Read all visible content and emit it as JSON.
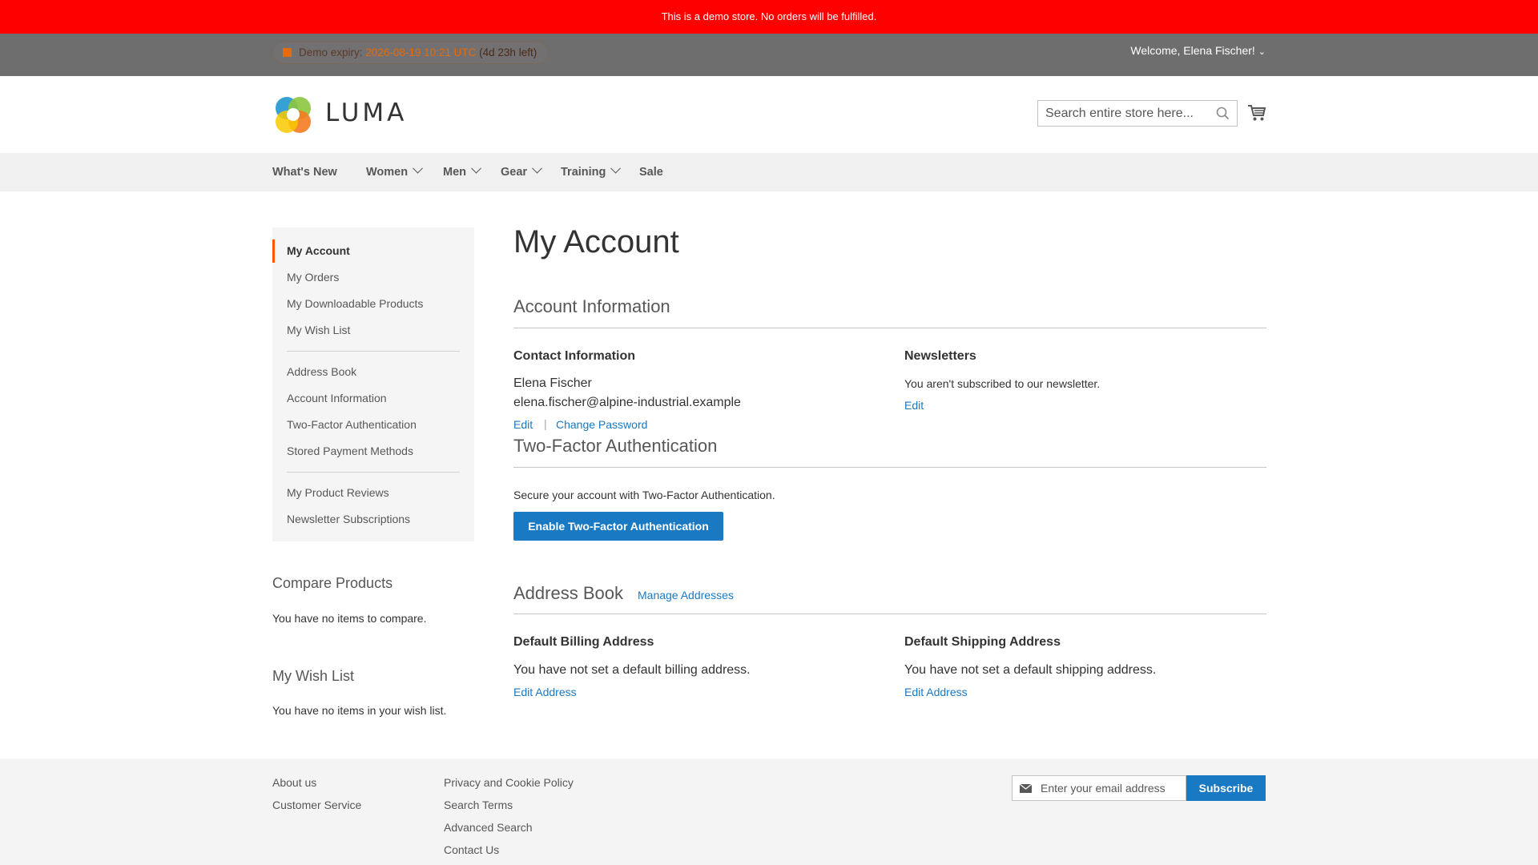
{
  "demo_notice": "This is a demo store. No orders will be fulfilled.",
  "panel": {
    "expiry_label": "Demo expiry:",
    "expiry_value": "2026-08-19 10:21 UTC",
    "expiry_left": "(4d 23h left)",
    "welcome": "Welcome, Elena Fischer!"
  },
  "header": {
    "logo_text": "LUMA",
    "search_placeholder": "Search entire store here..."
  },
  "nav": {
    "items": [
      "What's New",
      "Women",
      "Men",
      "Gear",
      "Training",
      "Sale"
    ]
  },
  "sidebar": {
    "group1": [
      "My Account",
      "My Orders",
      "My Downloadable Products",
      "My Wish List"
    ],
    "group2": [
      "Address Book",
      "Account Information",
      "Two-Factor Authentication",
      "Stored Payment Methods"
    ],
    "group3": [
      "My Product Reviews",
      "Newsletter Subscriptions"
    ],
    "compare_title": "Compare Products",
    "compare_text": "You have no items to compare.",
    "wishlist_title": "My Wish List",
    "wishlist_text": "You have no items in your wish list."
  },
  "main": {
    "title": "My Account",
    "account_info": {
      "title": "Account Information",
      "contact_title": "Contact Information",
      "name": "Elena Fischer",
      "email": "elena.fischer@alpine-industrial.example",
      "edit": "Edit",
      "separator": "|",
      "change_password": "Change Password",
      "newsletters_title": "Newsletters",
      "newsletters_text": "You aren't subscribed to our newsletter.",
      "newsletters_edit": "Edit"
    },
    "two_factor": {
      "title": "Two-Factor Authentication",
      "text": "Secure your account with Two-Factor Authentication.",
      "button": "Enable Two-Factor Authentication"
    },
    "address_book": {
      "title": "Address Book",
      "manage": "Manage Addresses",
      "billing_title": "Default Billing Address",
      "billing_text": "You have not set a default billing address.",
      "billing_edit": "Edit Address",
      "shipping_title": "Default Shipping Address",
      "shipping_text": "You have not set a default shipping address.",
      "shipping_edit": "Edit Address"
    }
  },
  "footer": {
    "col1": [
      "About us",
      "Customer Service"
    ],
    "col2": [
      "Privacy and Cookie Policy",
      "Search Terms",
      "Advanced Search",
      "Contact Us"
    ],
    "newsletter_placeholder": "Enter your email address",
    "subscribe": "Subscribe"
  },
  "colors": {
    "demo_banner": "#ff0000",
    "panel": "#6e6e6e",
    "accent": "#1979c3",
    "active_marker": "#ff5501",
    "expiry_highlight": "#e46c0a"
  }
}
